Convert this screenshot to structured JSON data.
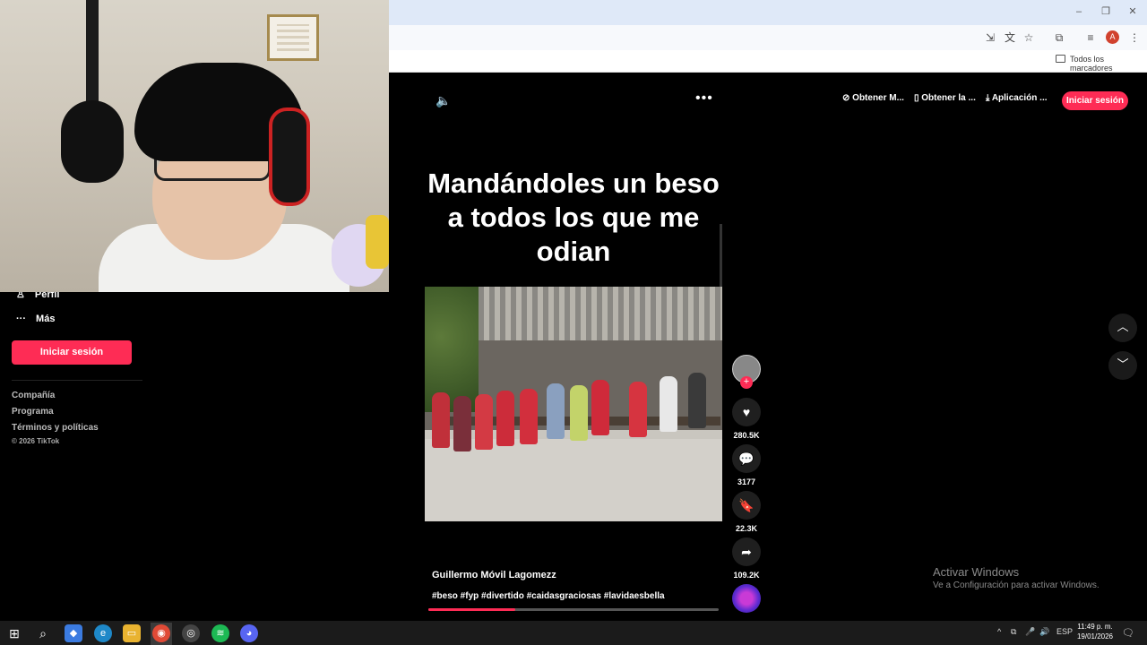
{
  "browser": {
    "bookmarks_label": "Todos los marcadores",
    "profile_initial": "A"
  },
  "tiktok_header": {
    "btn_obtener_m": "Obtener M...",
    "btn_obtener_la": "Obtener la ...",
    "btn_aplicacion": "Aplicación ...",
    "login": "Iniciar sesión"
  },
  "sidebar": {
    "perfil": "Perfil",
    "mas": "Más",
    "login": "Iniciar sesión",
    "links": [
      "Compañía",
      "Programa",
      "Términos y políticas"
    ],
    "copyright": "© 2026 TikTok"
  },
  "video": {
    "caption": "Mandándoles un beso a todos los que me odian",
    "author": "Guillermo Móvil Lagomezz",
    "tags": "#beso #fyp #divertido #caidasgraciosas #lavidaesbella",
    "progress": 0.3
  },
  "actions": {
    "likes": "280.5K",
    "comments": "3177",
    "saves": "22.3K",
    "shares": "109.2K"
  },
  "watermark": {
    "line1": "Activar Windows",
    "line2": "Ve a Configuración para activar Windows."
  },
  "taskbar": {
    "lang": "ESP",
    "time": "11:49 p. m.",
    "date": "19/01/2026"
  }
}
